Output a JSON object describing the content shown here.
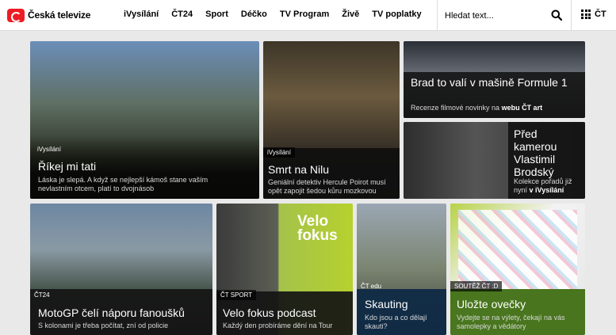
{
  "header": {
    "logo_text": "Česká televize",
    "nav": [
      "iVysílání",
      "ČT24",
      "Sport",
      "Déčko",
      "TV Program",
      "Živě",
      "TV poplatky"
    ],
    "search_placeholder": "Hledat text...",
    "menu_label": "ČT"
  },
  "cards": [
    {
      "tag": "iVysílání",
      "title": "Říkej mi tati",
      "desc": "Láska je slepá. A když se nejlepší kámoš stane vaším nevlastním otcem, platí to dvojnásob"
    },
    {
      "tag": "iVysílání",
      "title": "Smrt na Nilu",
      "desc": "Geniální detektiv Hercule Poirot musí opět zapojit šedou kůru mozkovou"
    },
    {
      "title": "Brad to valí v mašině Formule 1",
      "desc_pre": "Recenze filmové novinky na ",
      "desc_bold": "webu ČT art"
    },
    {
      "title": "Před kamerou Vlastimil Brodský",
      "desc_pre": "Kolekce pořadů již nyní ",
      "desc_bold": "v iVysílání"
    },
    {
      "tag": "ČT24",
      "title": "MotoGP čelí náporu fanoušků",
      "desc": "S kolonami je třeba počítat, zní od policie"
    },
    {
      "tag": "ČT SPORT",
      "title": "Velo fokus podcast",
      "desc": "Každý den probíráme dění na Tour",
      "image_text": "Velo fokus"
    },
    {
      "tag": "ČT edu",
      "title": "Skauting",
      "desc": "Kdo jsou a co dělají skauti?"
    },
    {
      "tag": "SOUTĚŽ ČT :D",
      "title": "Uložte ovečky",
      "desc": "Vydejte se na výlety, čekají na vás samolepky a vědátory"
    }
  ],
  "colors": {
    "brand_red": "#ed1c24",
    "overlay_dark": "#1a1a1a",
    "overlay_blue": "#0f2a46",
    "overlay_green": "#3f6f12"
  }
}
